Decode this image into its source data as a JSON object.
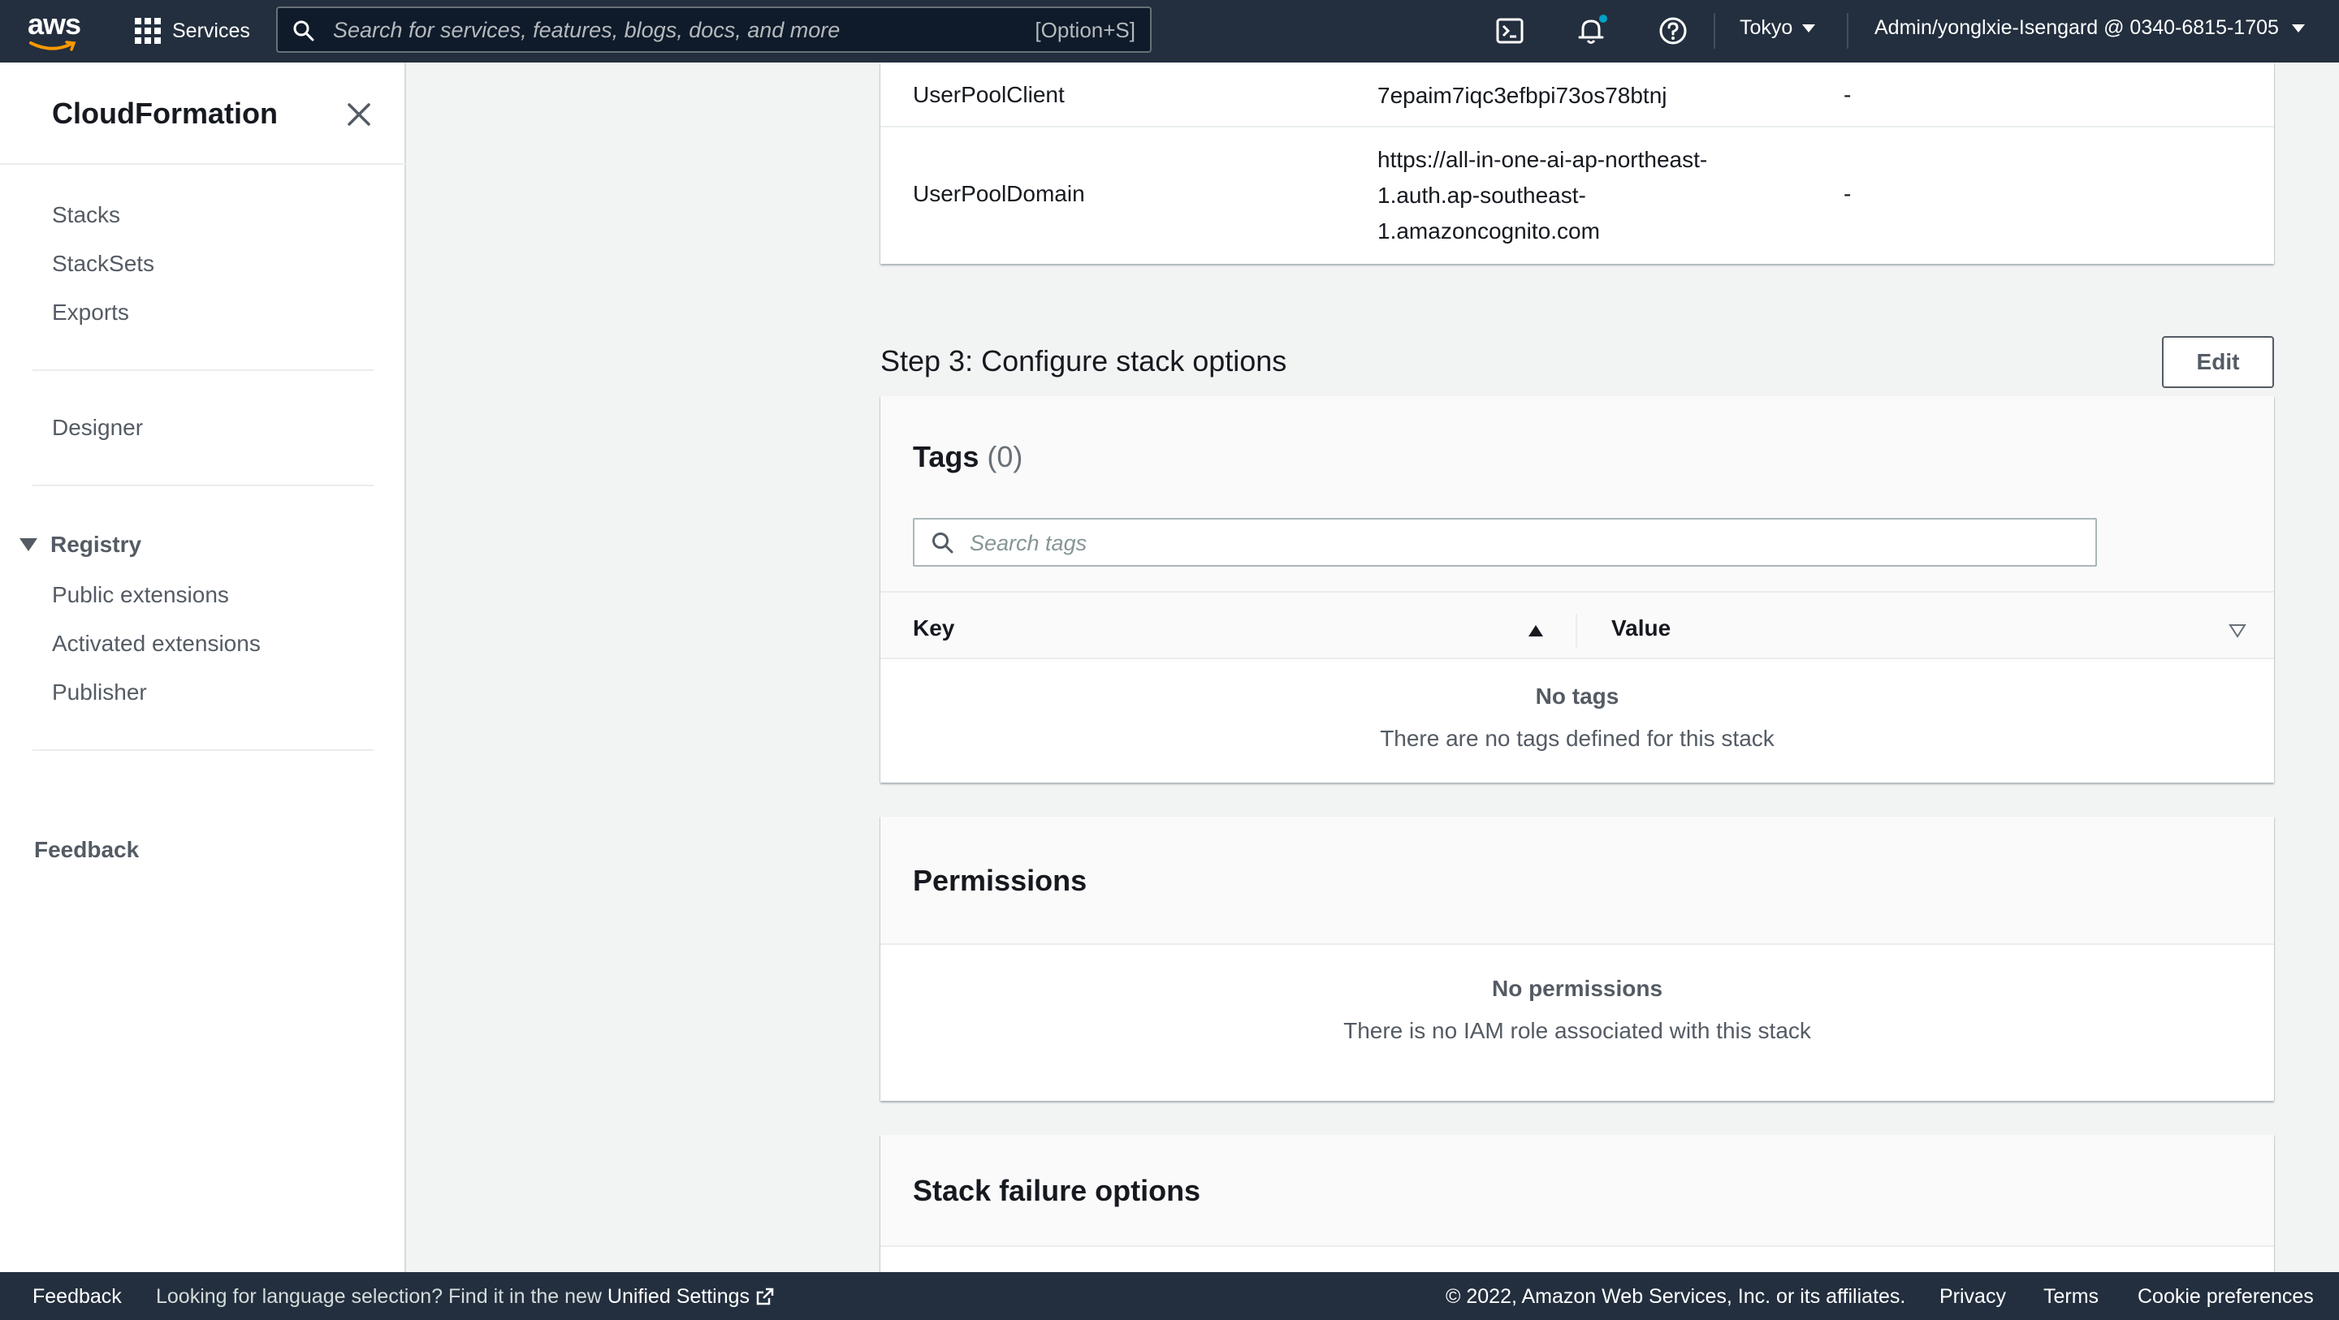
{
  "topnav": {
    "logo_text": "aws",
    "services_label": "Services",
    "search_placeholder": "Search for services, features, blogs, docs, and more",
    "search_shortcut": "[Option+S]",
    "region": "Tokyo",
    "account": "Admin/yonglxie-Isengard @ 0340-6815-1705"
  },
  "sidebar": {
    "title": "CloudFormation",
    "items": [
      {
        "label": "Stacks"
      },
      {
        "label": "StackSets"
      },
      {
        "label": "Exports"
      }
    ],
    "designer_label": "Designer",
    "registry_label": "Registry",
    "registry_items": [
      {
        "label": "Public extensions"
      },
      {
        "label": "Activated extensions"
      },
      {
        "label": "Publisher"
      }
    ],
    "feedback_label": "Feedback"
  },
  "outputs": {
    "rows": [
      {
        "key": "UserPoolClient",
        "value": "7epaim7iqc3efbpi73os78btnj",
        "desc": "-"
      },
      {
        "key": "UserPoolDomain",
        "value_lines": [
          "https://all-in-one-ai-ap-northeast-",
          "1.auth.ap-southeast-",
          "1.amazoncognito.com"
        ],
        "desc": "-"
      }
    ]
  },
  "step3": {
    "title": "Step 3: Configure stack options",
    "edit_label": "Edit"
  },
  "tags": {
    "title": "Tags",
    "count": "(0)",
    "search_placeholder": "Search tags",
    "col_key": "Key",
    "col_value": "Value",
    "empty_title": "No tags",
    "empty_desc": "There are no tags defined for this stack"
  },
  "permissions": {
    "title": "Permissions",
    "empty_title": "No permissions",
    "empty_desc": "There is no IAM role associated with this stack"
  },
  "failure": {
    "title": "Stack failure options"
  },
  "footer": {
    "feedback": "Feedback",
    "lang_text": "Looking for language selection? Find it in the new ",
    "lang_link": "Unified Settings",
    "copyright": "© 2022, Amazon Web Services, Inc. or its affiliates.",
    "privacy": "Privacy",
    "terms": "Terms",
    "cookie": "Cookie preferences"
  },
  "colors": {
    "nav_bg": "#232f3e",
    "page_bg": "#f2f3f3",
    "text": "#16191f",
    "muted": "#545b64",
    "accent_dot": "#00a1c9"
  }
}
